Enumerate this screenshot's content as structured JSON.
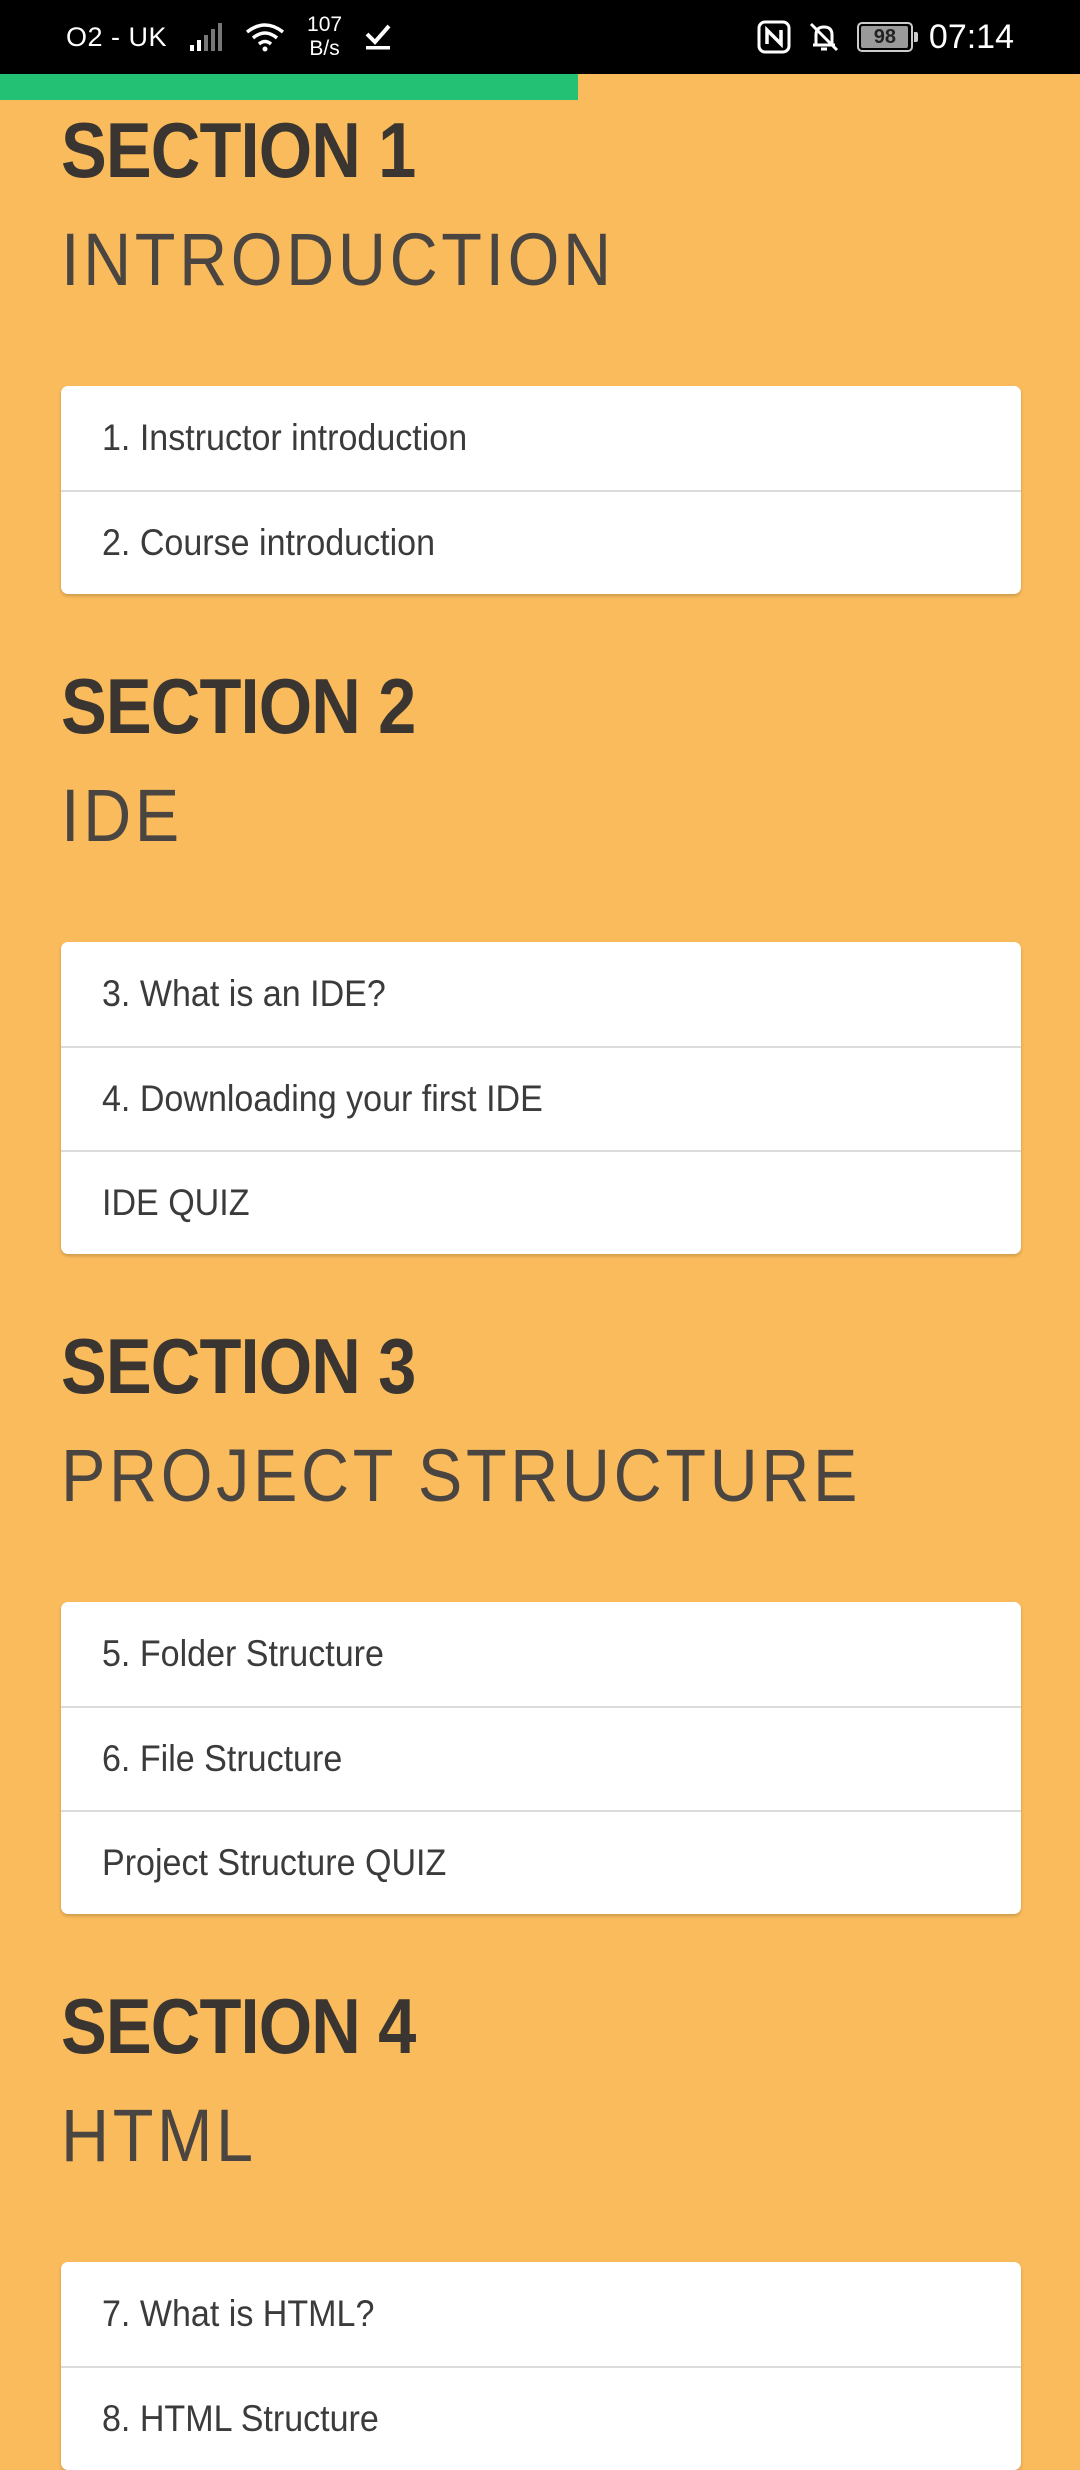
{
  "status_bar": {
    "carrier": "O2 - UK",
    "net_speed_value": "107",
    "net_speed_unit": "B/s",
    "battery_level": "98",
    "battery_fraction": 0.98,
    "time": "07:14"
  },
  "progress": {
    "fraction": 0.535,
    "color": "#22C174"
  },
  "colors": {
    "background": "#F9BB5B",
    "card": "#FFFFFF",
    "text": "#3B3B3B"
  },
  "sections": [
    {
      "number": "SECTION 1",
      "title": "INTRODUCTION",
      "lessons": [
        "1. Instructor introduction",
        "2. Course introduction"
      ]
    },
    {
      "number": "SECTION 2",
      "title": "IDE",
      "lessons": [
        "3. What is an IDE?",
        "4. Downloading your first IDE",
        "IDE QUIZ"
      ]
    },
    {
      "number": "SECTION 3",
      "title": "PROJECT STRUCTURE",
      "lessons": [
        "5. Folder Structure",
        "6. File Structure",
        "Project Structure QUIZ"
      ]
    },
    {
      "number": "SECTION 4",
      "title": "HTML",
      "lessons": [
        "7. What is HTML?",
        "8. HTML Structure"
      ]
    }
  ]
}
